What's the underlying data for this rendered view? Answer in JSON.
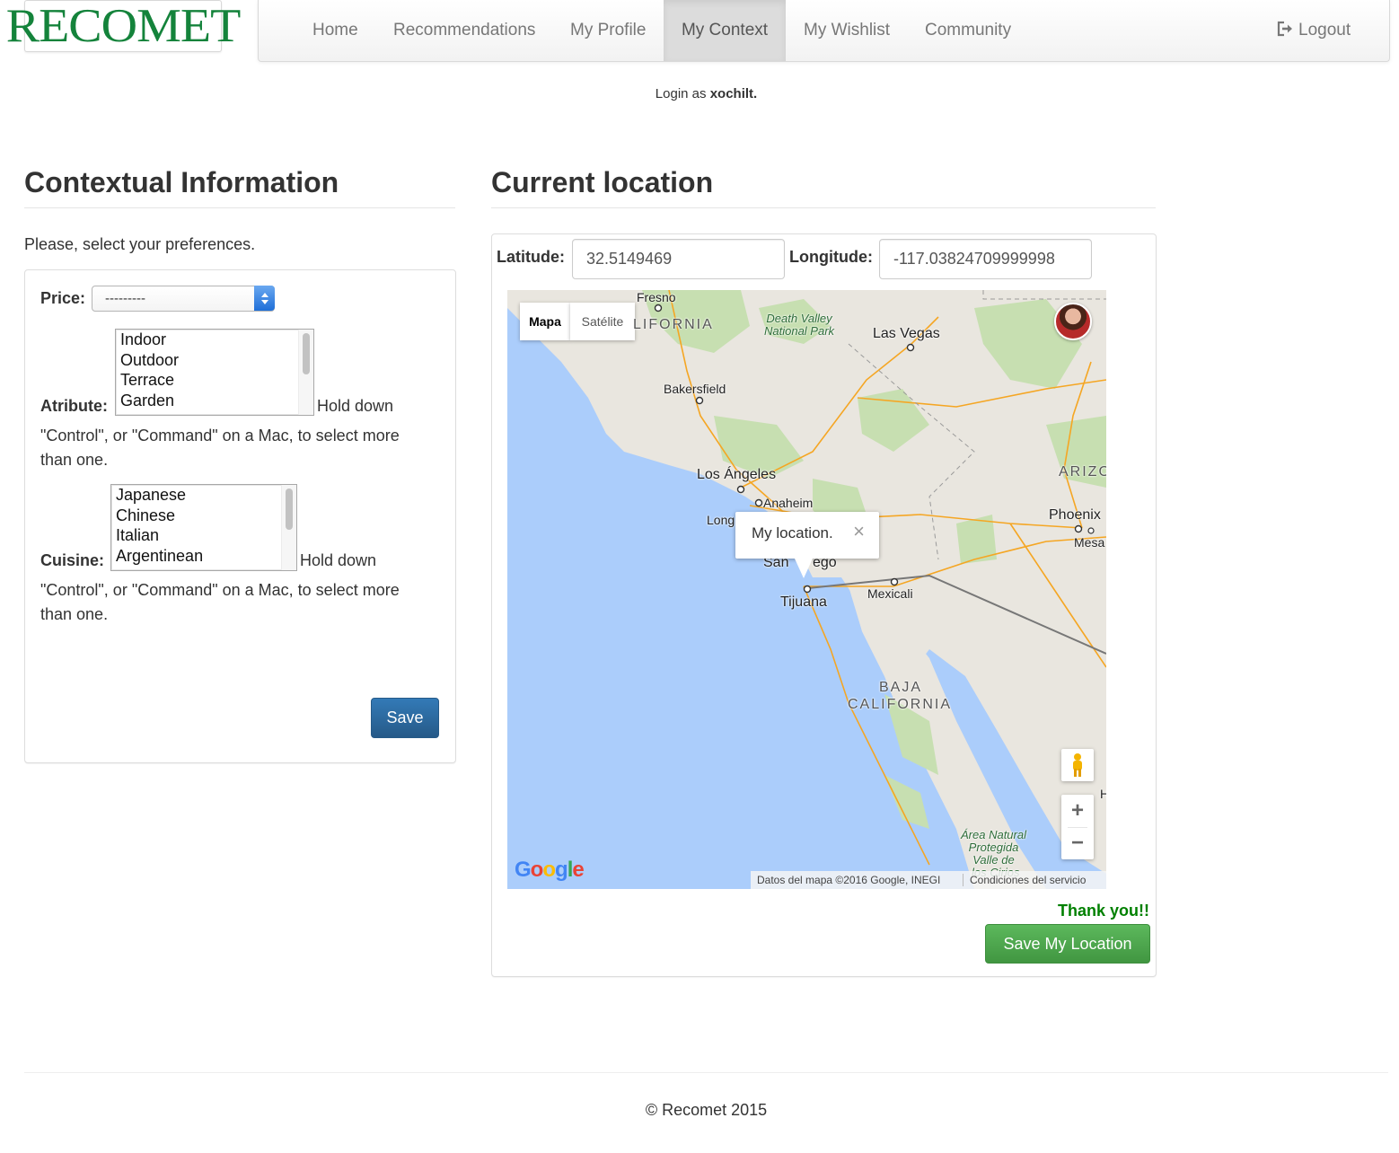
{
  "brand": {
    "logo_text": "RECOMET"
  },
  "nav": {
    "items": [
      "Home",
      "Recommendations",
      "My Profile",
      "My Context",
      "My Wishlist",
      "Community"
    ],
    "active": "My Context",
    "logout": "Logout"
  },
  "login": {
    "prefix": "Login as",
    "user": "xochilt."
  },
  "context": {
    "title": "Contextual Information",
    "intro": "Please, select your preferences.",
    "price_label": "Price:",
    "price_value": "---------",
    "atribute_label": "Atribute:",
    "atribute_options": [
      "Indoor",
      "Outdoor",
      "Terrace",
      "Garden"
    ],
    "cuisine_label": "Cuisine:",
    "cuisine_options": [
      "Japanese",
      "Chinese",
      "Italian",
      "Argentinean"
    ],
    "help_line1": "Hold down",
    "help_line2": "\"Control\", or \"Command\" on a Mac, to select more",
    "help_line3": "than one.",
    "save": "Save"
  },
  "location": {
    "title": "Current location",
    "latitude_label": "Latitude:",
    "latitude_value": "32.5149469",
    "longitude_label": "Longitude:",
    "longitude_value": "-117.03824709999998",
    "thank_you": "Thank you!!",
    "save": "Save My Location"
  },
  "map": {
    "type_map": "Mapa",
    "type_satellite": "Satélite",
    "infowindow": "My location.",
    "infowindow_close": "×",
    "zoom_in": "+",
    "zoom_out": "−",
    "logo": "Google",
    "attribution": "Datos del mapa ©2016 Google, INEGI",
    "terms": "Condiciones del servicio",
    "labels": {
      "fresno": "Fresno",
      "california": "LIFORNIA",
      "death_valley": "Death Valley\nNational Park",
      "las_vegas": "Las Vegas",
      "bakersfield": "Bakersfield",
      "los_angeles": "Los Ángeles",
      "anaheim": "Anaheim",
      "long": "Long",
      "san": "San",
      "ego": "ego",
      "tijuana": "Tijuana",
      "mexicali": "Mexicali",
      "phoenix": "Phoenix",
      "mesa": "Mesa",
      "arizona": "ARIZO",
      "baja": "BAJA",
      "baja_california": "CALIFORNIA",
      "area_natural": "Área Natural\nProtegida\nValle de",
      "los_cirios": "los Cirios",
      "h": "H"
    },
    "colors": {
      "water": "#abcdfb",
      "land": "#e9e6df",
      "green": "#c7dfb1",
      "road": "#f5a623"
    }
  },
  "footer": "© Recomet 2015"
}
